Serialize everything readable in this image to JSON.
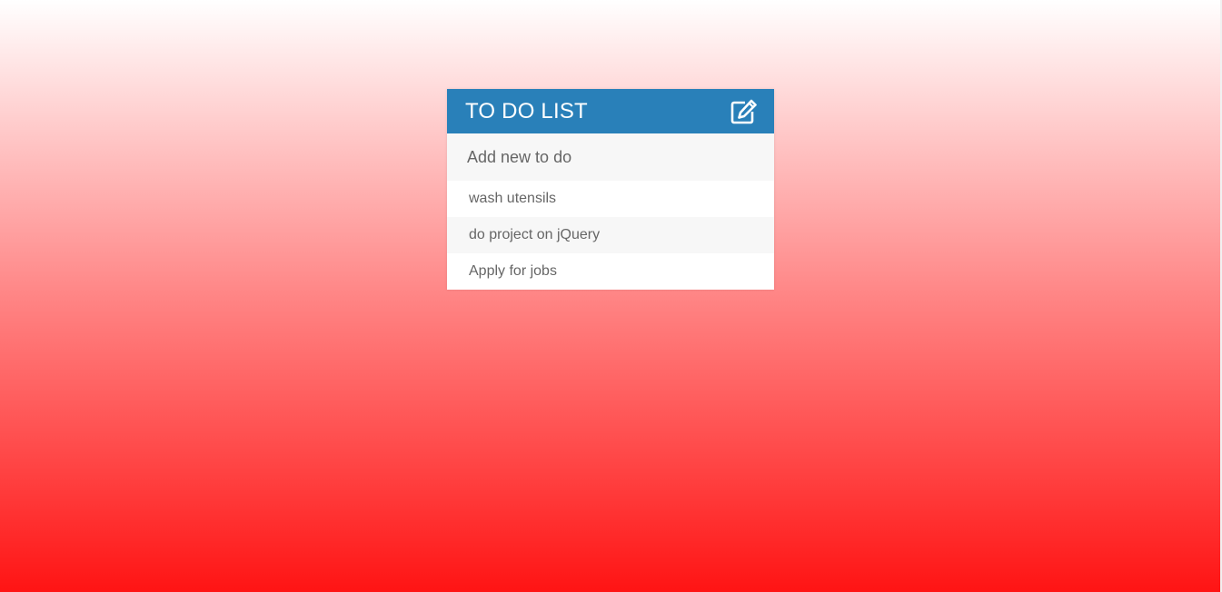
{
  "app": {
    "title": "TO DO LIST",
    "toggle_icon": "edit-icon"
  },
  "input": {
    "placeholder": "Add new to do",
    "value": ""
  },
  "todos": [
    {
      "text": "wash utensils"
    },
    {
      "text": "do project on jQuery"
    },
    {
      "text": "Apply for jobs"
    }
  ],
  "colors": {
    "header": "#2980b9",
    "gradient_top": "#ffffff",
    "gradient_bottom": "#ff1414",
    "item_text": "#666666",
    "input_bg": "#f7f7f7"
  }
}
